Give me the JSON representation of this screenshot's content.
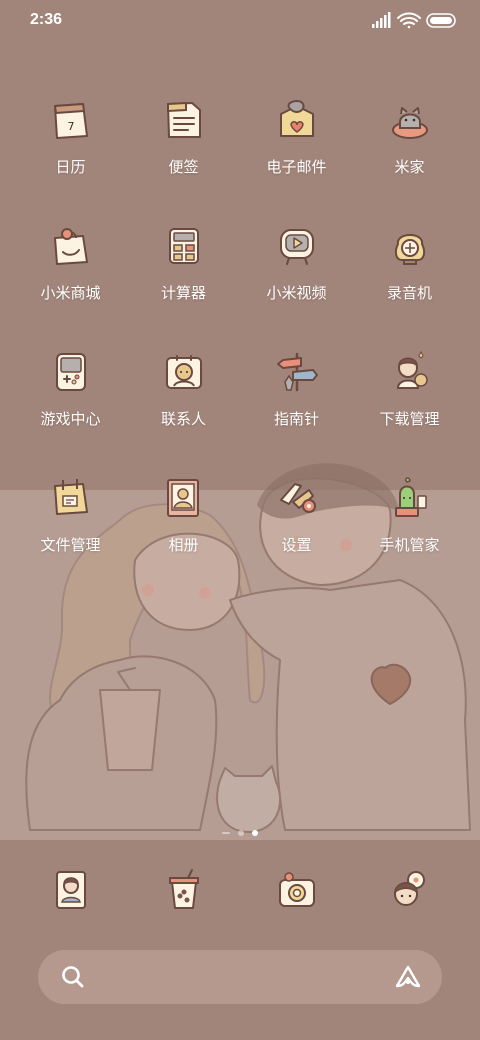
{
  "status_bar": {
    "time": "2:36",
    "icons": [
      "signal-icon",
      "wifi-icon",
      "battery-icon"
    ]
  },
  "apps": [
    {
      "label": "日历",
      "icon": "calendar-icon",
      "badge_text": "7"
    },
    {
      "label": "便签",
      "icon": "notes-icon"
    },
    {
      "label": "电子邮件",
      "icon": "email-icon"
    },
    {
      "label": "米家",
      "icon": "mijia-icon"
    },
    {
      "label": "小米商城",
      "icon": "mi-store-icon"
    },
    {
      "label": "计算器",
      "icon": "calculator-icon"
    },
    {
      "label": "小米视频",
      "icon": "mi-video-icon"
    },
    {
      "label": "录音机",
      "icon": "recorder-icon"
    },
    {
      "label": "游戏中心",
      "icon": "game-center-icon"
    },
    {
      "label": "联系人",
      "icon": "contacts-icon"
    },
    {
      "label": "指南针",
      "icon": "compass-icon"
    },
    {
      "label": "下载管理",
      "icon": "downloads-icon"
    },
    {
      "label": "文件管理",
      "icon": "file-manager-icon"
    },
    {
      "label": "相册",
      "icon": "gallery-icon"
    },
    {
      "label": "设置",
      "icon": "settings-icon"
    },
    {
      "label": "手机管家",
      "icon": "security-icon"
    }
  ],
  "page_indicator": {
    "pages": 3,
    "active_index": 2
  },
  "dock": [
    {
      "icon": "phone-icon"
    },
    {
      "icon": "messages-icon"
    },
    {
      "icon": "camera-icon"
    },
    {
      "icon": "browser-icon"
    }
  ],
  "search_bar": {
    "left_icon": "search-icon",
    "right_icon": "assistant-icon"
  },
  "colors": {
    "wallpaper": "#a2857a",
    "wallpaper_light": "#b59d94",
    "line_art": "#6a4a40",
    "icon_fill": "#fdf3e3",
    "text": "#ffffff"
  }
}
